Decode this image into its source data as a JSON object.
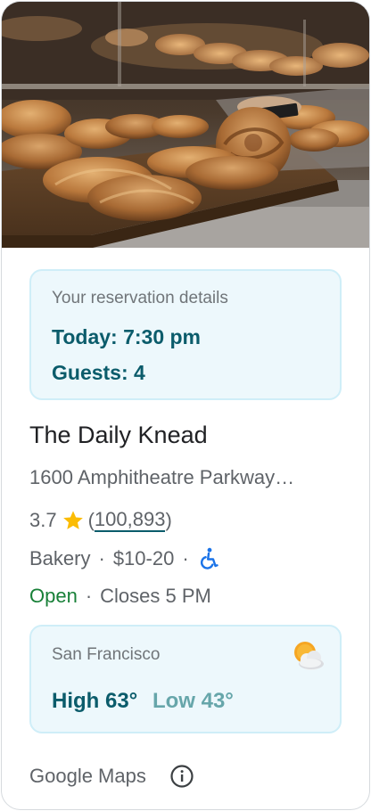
{
  "reservation": {
    "heading": "Your reservation details",
    "time": "Today: 7:30 pm",
    "guests": "Guests: 4"
  },
  "place": {
    "name": "The Daily Knead",
    "address": "1600 Amphitheatre Parkway…",
    "rating": "3.7",
    "review_count": "100,893",
    "category": "Bakery",
    "price": "$10-20",
    "open_status": "Open",
    "closes": "Closes 5 PM",
    "separator": "·"
  },
  "weather": {
    "city": "San Francisco",
    "high": "High 63°",
    "low": "Low 43°",
    "icon": "partly-cloudy-icon"
  },
  "footer": {
    "source": "Google Maps",
    "info_icon": "info-icon"
  },
  "colors": {
    "accent": "#0b5c6b",
    "open": "#188038",
    "panel_bg": "#edf8fc",
    "star": "#fbbc04"
  }
}
